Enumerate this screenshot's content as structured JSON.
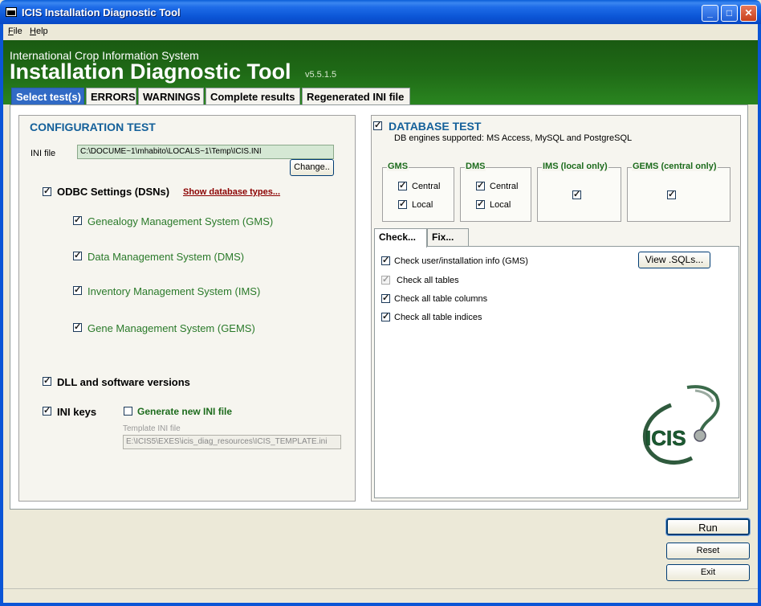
{
  "window": {
    "title": "ICIS Installation Diagnostic Tool"
  },
  "menu": {
    "file": "File",
    "help": "Help"
  },
  "banner": {
    "subtitle": "International Crop Information System",
    "title": "Installation Diagnostic Tool",
    "version": "v5.5.1.5"
  },
  "tabs": [
    "Select test(s)",
    "ERRORS",
    "WARNINGS",
    "Complete results",
    "Regenerated INI file"
  ],
  "config": {
    "heading": "CONFIGURATION TEST",
    "ini_label": "INI file",
    "ini_value": "C:\\DOCUME~1\\mhabito\\LOCALS~1\\Temp\\ICIS.INI",
    "change_button": "Change..",
    "odbc_label": "ODBC Settings (DSNs)",
    "show_db_types": "Show database types...",
    "dsn_items": [
      "Genealogy Management System (GMS)",
      "Data Management System (DMS)",
      "Inventory Management System (IMS)",
      "Gene Management System (GEMS)"
    ],
    "dll_label": "DLL and software versions",
    "ini_keys_label": "INI keys",
    "generate_ini_label": "Generate new INI file",
    "template_label": "Template INI file",
    "template_value": "E:\\ICIS5\\EXES\\icis_diag_resources\\ICIS_TEMPLATE.ini"
  },
  "database": {
    "heading": "DATABASE TEST",
    "engines": "DB engines supported: MS Access, MySQL and PostgreSQL",
    "gms": {
      "title": "GMS",
      "central": "Central",
      "local": "Local"
    },
    "dms": {
      "title": "DMS",
      "central": "Central",
      "local": "Local"
    },
    "ims": {
      "title": "IMS (local only)"
    },
    "gems": {
      "title": "GEMS (central only)"
    },
    "subtabs": [
      "Check...",
      "Fix..."
    ],
    "checks": [
      "Check user/installation info (GMS)",
      "Check all tables",
      "Check all table columns",
      "Check all table indices"
    ],
    "view_sqls": "View .SQLs...",
    "logo_text": "ICIS"
  },
  "actions": {
    "run": "Run",
    "reset": "Reset",
    "exit": "Exit"
  }
}
